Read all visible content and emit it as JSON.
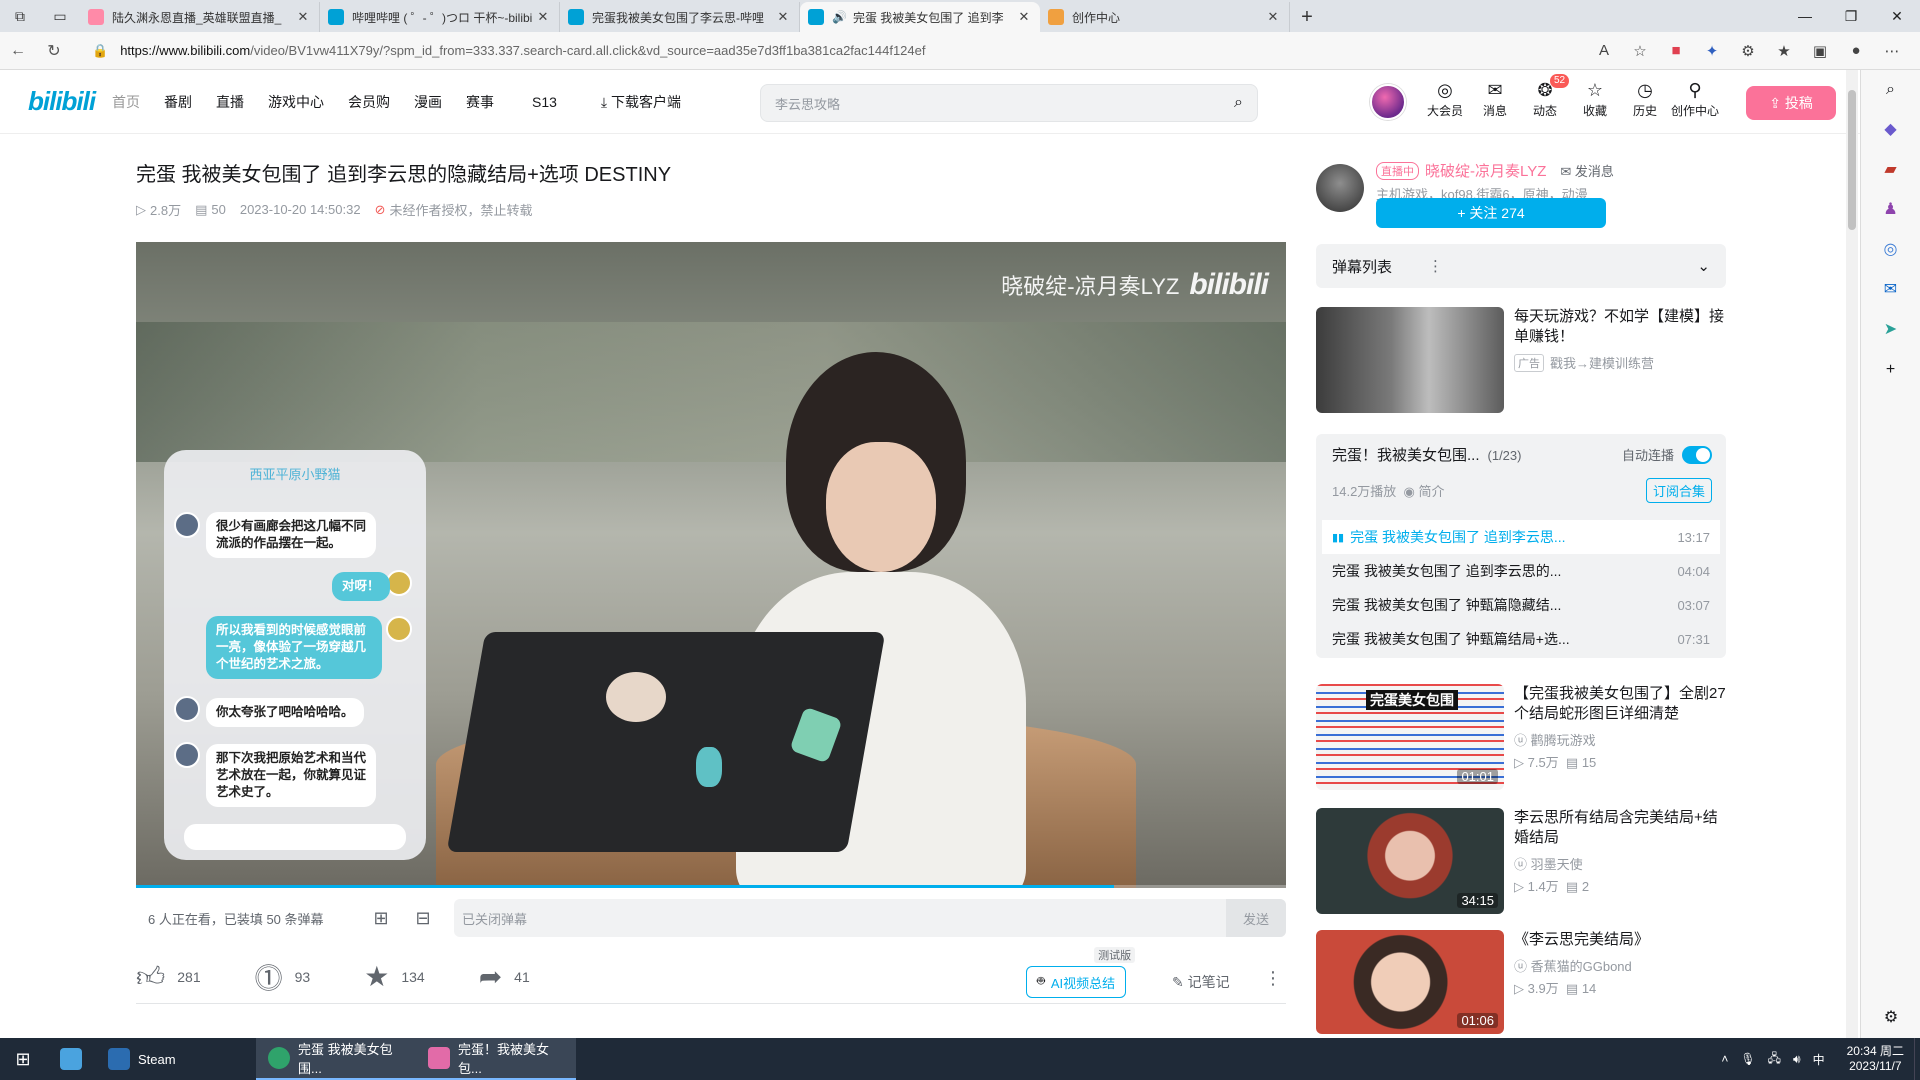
{
  "browser": {
    "tabs": [
      {
        "title": "陆久渊永恩直播_英雄联盟直播_",
        "color": "#ff8aa8"
      },
      {
        "title": "哔哩哔哩 ( ゜- ゜)つロ 干杯~-bilibi",
        "color": "#00a1d6"
      },
      {
        "title": "完蛋我被美女包围了李云思-哔哩",
        "color": "#00a1d6"
      },
      {
        "title": "完蛋 我被美女包围了 追到李",
        "color": "#00a1d6",
        "active": true
      },
      {
        "title": "创作中心",
        "color": "#f0a040"
      }
    ],
    "url_host": "https://www.bilibili.com",
    "url_path": "/video/BV1vw411X79y/?spm_id_from=333.337.search-card.all.click&vd_source=aad35e7d3ff1ba381ca2fac144f124ef"
  },
  "header": {
    "logo": "bilibili",
    "nav": [
      "首页",
      "番剧",
      "直播",
      "游戏中心",
      "会员购",
      "漫画",
      "赛事",
      "S13",
      "下载客户端"
    ],
    "search_placeholder": "李云思攻略",
    "right_nav": [
      {
        "label": "大会员",
        "icon": "vip-icon"
      },
      {
        "label": "消息",
        "icon": "message-icon"
      },
      {
        "label": "动态",
        "icon": "dynamic-icon",
        "badge": "52"
      },
      {
        "label": "收藏",
        "icon": "favorite-icon"
      },
      {
        "label": "历史",
        "icon": "history-icon"
      },
      {
        "label": "创作中心",
        "icon": "creator-icon"
      }
    ],
    "upload_label": "投稿"
  },
  "video": {
    "title": "完蛋 我被美女包围了 追到李云思的隐藏结局+选项 DESTINY",
    "views": "2.8万",
    "danmaku_count": "50",
    "datetime": "2023-10-20 14:50:32",
    "copyright": "未经作者授权，禁止转载",
    "watermark_name": "晓破绽-凉月奏LYZ",
    "watermark_logo": "bilibili",
    "progress": 0.85,
    "chat": {
      "title": "西亚平原小野猫",
      "messages": [
        {
          "side": "l",
          "text": "很少有画廊会把这几幅不同流派的作品摆在一起。"
        },
        {
          "side": "r",
          "text": "对呀！"
        },
        {
          "side": "r",
          "text": "所以我看到的时候感觉眼前一亮，像体验了一场穿越几个世纪的艺术之旅。"
        },
        {
          "side": "l",
          "text": "你太夸张了吧哈哈哈哈。"
        },
        {
          "side": "l",
          "text": "那下次我把原始艺术和当代艺术放在一起，你就算见证艺术史了。"
        }
      ]
    },
    "viewers_text": "6 人正在看，已装填 50 条弹幕",
    "danmaku_placeholder": "已关闭弹幕",
    "send_label": "发送",
    "likes": "281",
    "coins": "93",
    "favorites": "134",
    "shares": "41",
    "ai_summary_label": "AI视频总结",
    "beta_label": "测试版",
    "notes_label": "记笔记"
  },
  "uploader": {
    "live_label": "直播中",
    "name": "晓破绽-凉月奏LYZ",
    "message_label": "发消息",
    "desc": "主机游戏，kof98,街霸6，原神，动漫",
    "follow_label": "+ 关注 274"
  },
  "danmaku_list": {
    "label": "弹幕列表"
  },
  "ad": {
    "title": "每天玩游戏？不如学【建模】接单赚钱！",
    "tag": "广告",
    "source": "戳我→建模训练营"
  },
  "playlist": {
    "title": "完蛋！我被美女包围...",
    "count": "(1/23)",
    "autoplay_label": "自动连播",
    "plays": "14.2万播放",
    "intro_label": "简介",
    "subscribe_label": "订阅合集",
    "items": [
      {
        "title": "完蛋 我被美女包围了 追到李云思...",
        "duration": "13:17",
        "current": true
      },
      {
        "title": "完蛋 我被美女包围了 追到李云思的...",
        "duration": "04:04"
      },
      {
        "title": "完蛋 我被美女包围了 钟甄篇隐藏结...",
        "duration": "03:07"
      },
      {
        "title": "完蛋 我被美女包围了 钟甄篇结局+选...",
        "duration": "07:31"
      }
    ]
  },
  "recommendations": [
    {
      "title": "【完蛋我被美女包围了】全剧27个结局蛇形图巨详细清楚",
      "uploader": "鹳腾玩游戏",
      "views": "7.5万",
      "danmaku": "15",
      "duration": "01:01",
      "thumb_text": "完蛋美女包围"
    },
    {
      "title": "李云思所有结局含完美结局+结婚结局",
      "uploader": "羽墨天使",
      "views": "1.4万",
      "danmaku": "2",
      "duration": "34:15"
    },
    {
      "title": "《李云思完美结局》",
      "uploader": "香蕉猫的GGbond",
      "views": "3.9万",
      "danmaku": "14",
      "duration": "01:06"
    }
  ],
  "taskbar": {
    "apps": [
      {
        "label": "Steam",
        "color": "#2b6cb0"
      },
      {
        "label": "完蛋 我被美女包围...",
        "color": "#2fa36b",
        "active": true
      },
      {
        "label": "完蛋！我被美女包...",
        "color": "#e26ba8",
        "active": true
      }
    ],
    "time": "20:34 周二",
    "date": "2023/11/7",
    "ime": "中"
  }
}
